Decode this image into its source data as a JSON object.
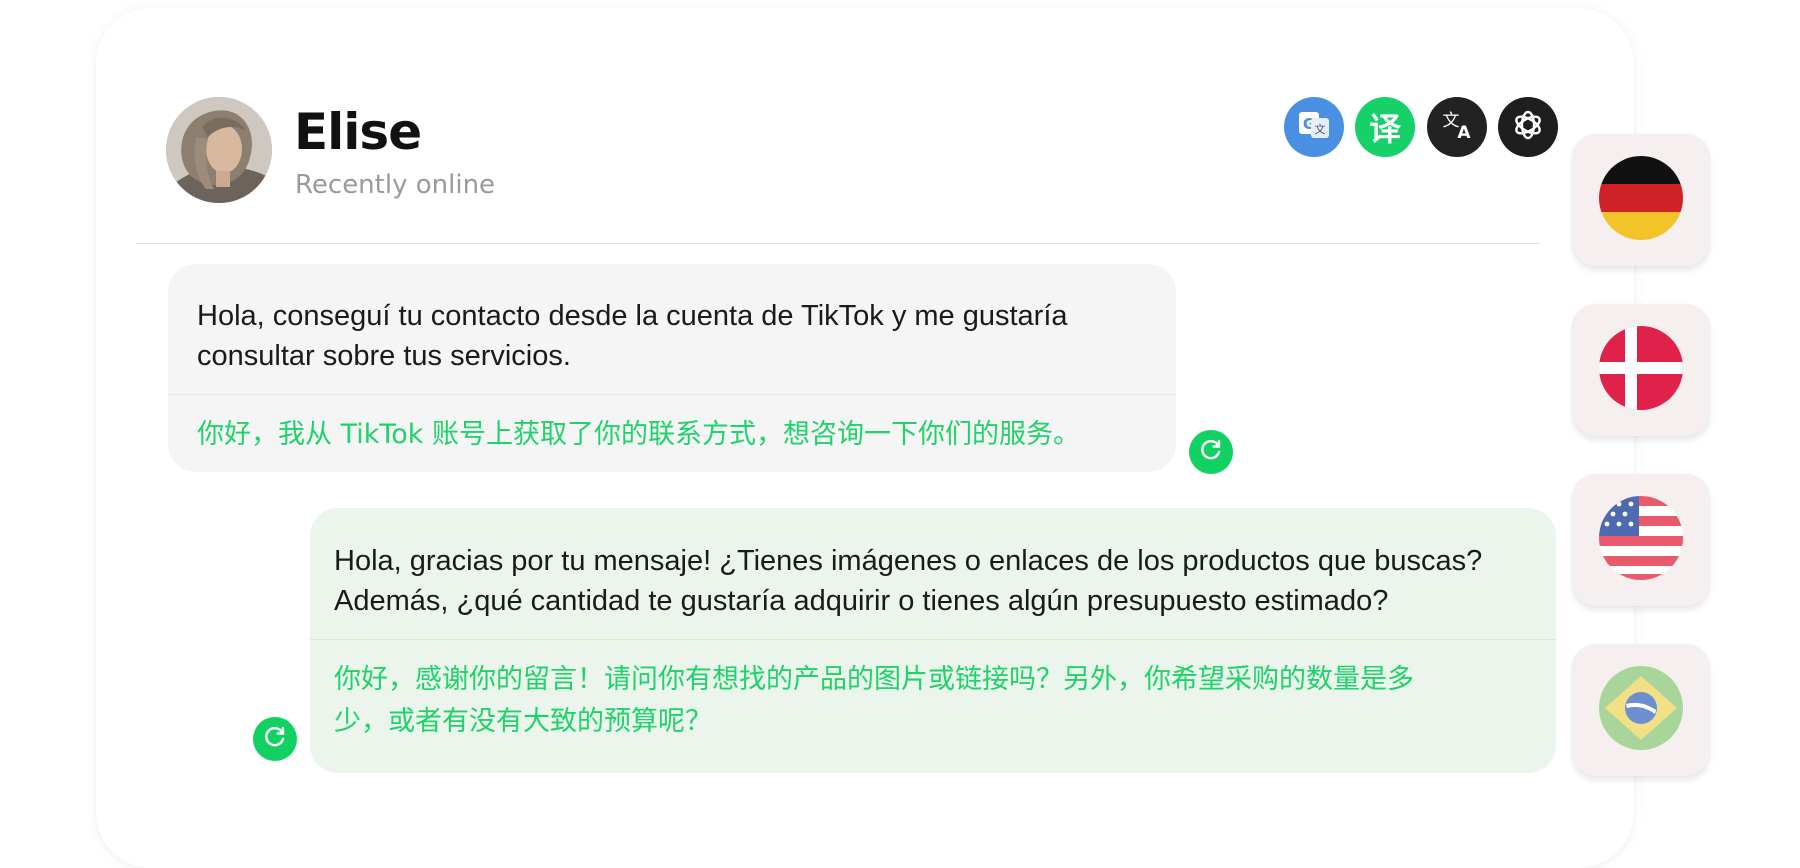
{
  "contact": {
    "name": "Elise",
    "status": "Recently online",
    "avatar_icon": "avatar-photo"
  },
  "translation_engines": [
    {
      "name": "google-translate-icon",
      "color": "#4a90e2",
      "glyph": "G"
    },
    {
      "name": "chinese-translate-icon",
      "color": "#16d169",
      "glyph": "译"
    },
    {
      "name": "translate-icon",
      "color": "#222222",
      "glyph": "文A"
    },
    {
      "name": "openai-icon",
      "color": "#1e1e1e",
      "glyph": "knot"
    }
  ],
  "messages": [
    {
      "direction": "incoming",
      "original": [
        "Hola, conseguí tu contacto desde la cuenta de TikTok y me gustaría",
        "consultar sobre tus servicios."
      ],
      "translation": [
        "你好，我从 TikTok 账号上获取了你的联系方式，想咨询一下你们的服务。"
      ]
    },
    {
      "direction": "outgoing",
      "original": [
        "Hola, gracias por tu mensaje! ¿Tienes imágenes o enlaces de los productos que buscas?",
        "Además, ¿qué cantidad te gustaría adquirir o tienes algún presupuesto estimado?"
      ],
      "translation": [
        "你好，感谢你的留言！请问你有想找的产品的图片或链接吗？另外，你希望采购的数量是多",
        "少，或者有没有大致的预算呢？"
      ]
    }
  ],
  "languages": [
    {
      "name": "germany-flag-icon"
    },
    {
      "name": "denmark-flag-icon"
    },
    {
      "name": "usa-flag-icon"
    },
    {
      "name": "brazil-flag-icon"
    }
  ],
  "colors": {
    "accent_green": "#12d163",
    "translation_text": "#1fd36a",
    "incoming_bubble": "#f5f5f5",
    "outgoing_bubble": "#ebf5ec"
  }
}
